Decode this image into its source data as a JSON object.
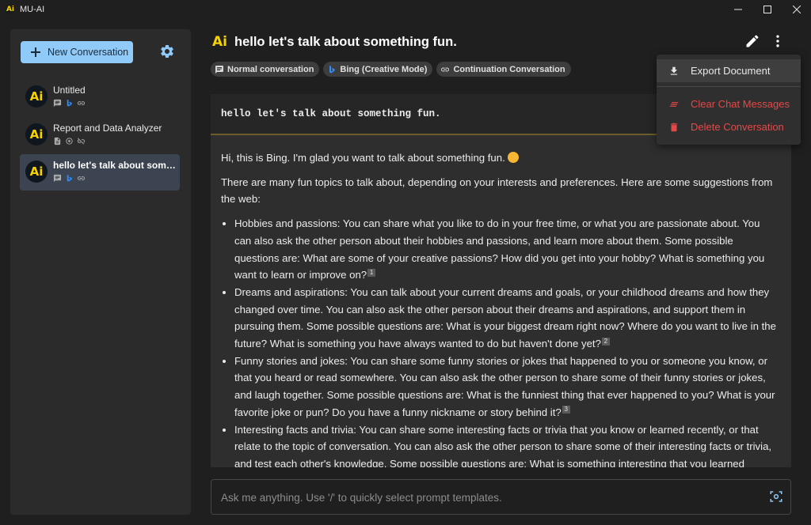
{
  "window": {
    "title": "MU-AI"
  },
  "sidebar": {
    "new_conversation_label": "New Conversation",
    "conversations": [
      {
        "title": "Untitled",
        "icons": [
          "chat-icon",
          "bing-icon",
          "link-icon"
        ]
      },
      {
        "title": "Report and Data Analyzer",
        "icons": [
          "document-icon",
          "openai-icon",
          "link-off-icon"
        ]
      },
      {
        "title": "hello let's talk about something fun.",
        "icons": [
          "chat-icon",
          "bing-icon",
          "link-icon"
        ],
        "active": true
      }
    ]
  },
  "header": {
    "title": "hello let's talk about something fun.",
    "chips": [
      {
        "label": "Normal conversation",
        "icon": "chat-icon"
      },
      {
        "label": "Bing (Creative Mode)",
        "icon": "bing-icon"
      },
      {
        "label": "Continuation Conversation",
        "icon": "link-icon"
      }
    ]
  },
  "menu": {
    "items": [
      {
        "label": "Export Document",
        "icon": "download-icon",
        "color": "#e8e8e8"
      },
      {
        "label": "Clear Chat Messages",
        "icon": "clear-icon",
        "color": "#e54848"
      },
      {
        "label": "Delete Conversation",
        "icon": "trash-icon",
        "color": "#e54848"
      }
    ]
  },
  "chat": {
    "user_message": "hello let's talk about something fun.",
    "bot_intro": "Hi, this is Bing. I'm glad you want to talk about something fun.",
    "bot_para": "There are many fun topics to talk about, depending on your interests and preferences. Here are some suggestions from the web:",
    "bullets": [
      {
        "text": "Hobbies and passions: You can share what you like to do in your free time, or what you are passionate about. You can also ask the other person about their hobbies and passions, and learn more about them. Some possible questions are: What are some of your creative passions? How did you get into your hobby? What is something you want to learn or improve on?",
        "ref": "1"
      },
      {
        "text": "Dreams and aspirations: You can talk about your current dreams and goals, or your childhood dreams and how they changed over time. You can also ask the other person about their dreams and aspirations, and support them in pursuing them. Some possible questions are: What is your biggest dream right now? Where do you want to live in the future? What is something you have always wanted to do but haven't done yet?",
        "ref": "2"
      },
      {
        "text": "Funny stories and jokes: You can share some funny stories or jokes that happened to you or someone you know, or that you heard or read somewhere. You can also ask the other person to share some of their funny stories or jokes, and laugh together. Some possible questions are: What is the funniest thing that ever happened to you? What is your favorite joke or pun? Do you have a funny nickname or story behind it?",
        "ref": "3"
      },
      {
        "text": "Interesting facts and trivia: You can share some interesting facts or trivia that you know or learned recently, or that relate to the topic of conversation. You can also ask the other person to share some of their interesting facts or trivia, and test each other's knowledge. Some possible questions are: What is something interesting that you learned today?",
        "ref": ""
      }
    ]
  },
  "input": {
    "placeholder": "Ask me anything. Use '/' to quickly select prompt templates."
  },
  "colors": {
    "accent": "#90caf9",
    "brand_yellow": "#f5d200",
    "danger": "#e54848",
    "bing_blue": "#2f8dff"
  }
}
